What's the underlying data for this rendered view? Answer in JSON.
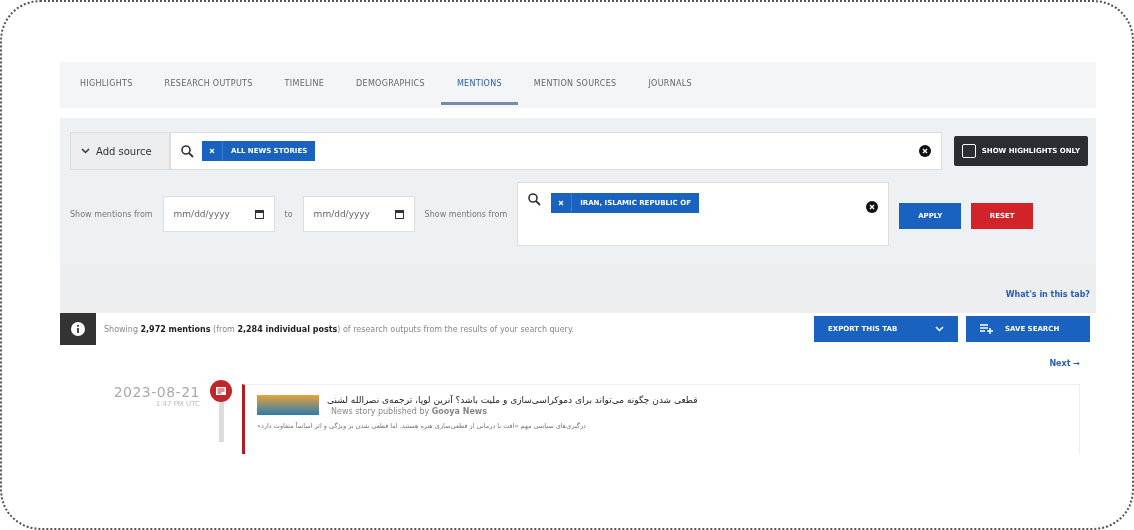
{
  "tabs": [
    {
      "label": "HIGHLIGHTS",
      "selected": false
    },
    {
      "label": "RESEARCH OUTPUTS",
      "selected": false
    },
    {
      "label": "TIMELINE",
      "selected": false
    },
    {
      "label": "DEMOGRAPHICS",
      "selected": false
    },
    {
      "label": "MENTIONS",
      "selected": true
    },
    {
      "label": "MENTION SOURCES",
      "selected": false
    },
    {
      "label": "JOURNALS",
      "selected": false
    }
  ],
  "filters": {
    "add_source": "Add source",
    "source_tags": [
      "ALL NEWS STORIES"
    ],
    "highlights_only": {
      "label": "SHOW HIGHLIGHTS ONLY",
      "checked": false
    },
    "date_label": "Show mentions from",
    "date_from": {
      "placeholder": "mm/dd/yyyy"
    },
    "to_label": "to",
    "date_to": {
      "placeholder": "mm/dd/yyyy"
    },
    "country_label": "Show mentions from",
    "country_tags": [
      "IRAN, ISLAMIC REPUBLIC OF"
    ],
    "apply": "APPLY",
    "reset": "RESET"
  },
  "help_link": "What's in this tab?",
  "summary": {
    "text": "Showing **2,972 mentions** (from **2,284 individual posts**) of research outputs from the results of your search query.",
    "export": "EXPORT THIS TAB",
    "save": "SAVE SEARCH"
  },
  "next": "Next →",
  "mentions": [
    {
      "date": "2023-08-21",
      "time": "1:47 PM UTC",
      "title": "قطعی شدن چگونه می‌تواند برای دموکراسی‌سازی و ملیت باشد؟ آنرین لوپا، ترجمه‌ی نصرالله لشنی",
      "byline": "News story published by **Gooya News**",
      "snippet": "درگیری‌های سیاسی مهم «اقت با درمانی از قطعی‌سازی هنره هستند، اما قطعی شدن بر ویژگی و اثر اساساً متفاوت دارد»"
    }
  ]
}
